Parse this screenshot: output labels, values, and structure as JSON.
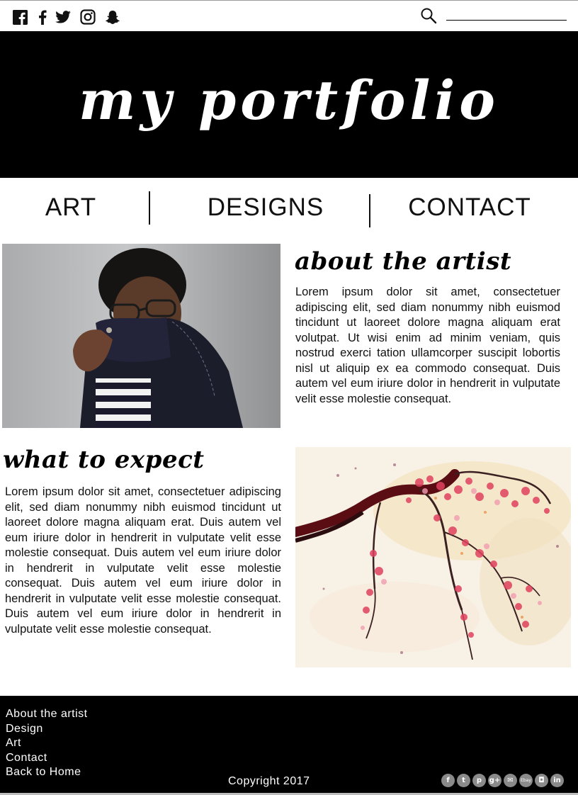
{
  "topbar": {
    "social_icons": [
      "facebook-square-icon",
      "facebook-icon",
      "twitter-icon",
      "instagram-icon",
      "snapchat-icon"
    ],
    "search": {
      "icon": "search-icon",
      "value": "",
      "placeholder": ""
    }
  },
  "hero": {
    "title": "my portfolio"
  },
  "nav": {
    "items": [
      "ART",
      "DESIGNS",
      "CONTACT"
    ]
  },
  "about": {
    "heading": "about the artist",
    "body": "Lorem ipsum dolor sit amet, consectetuer adipiscing elit, sed diam nonummy nibh euismod tincidunt ut laoreet dolore magna aliquam erat volutpat. Ut wisi enim ad minim veniam, quis nostrud exerci tation ullamcorper suscipit lobortis nisl ut aliquip ex ea commodo consequat. Duis autem vel eum iriure dolor in hendrerit in vulputate velit esse molestie consequat."
  },
  "expect": {
    "heading": "what to expect",
    "body": "Lorem ipsum dolor sit amet, consectetuer adipiscing elit, sed diam nonummy nibh euismod tincidunt ut laoreet dolore magna aliquam erat. Duis autem vel eum iriure dolor in hendrerit in vulputate velit esse molestie consequat. Duis autem vel eum iriure dolor in hendrerit in vulputate velit esse molestie consequat. Duis autem vel eum iriure dolor in hendrerit in vulputate velit esse molestie consequat. Duis autem vel eum iriure dolor in hendrerit in vulputate velit esse molestie consequat."
  },
  "footer": {
    "links": [
      "About the artist",
      "Design",
      "Art",
      "Contact",
      "Back to Home"
    ],
    "copyright": "Copyright 2017",
    "social_icons": [
      {
        "icon": "facebook-icon",
        "glyph": "f"
      },
      {
        "icon": "twitter-icon",
        "glyph": "t"
      },
      {
        "icon": "pinterest-icon",
        "glyph": "p"
      },
      {
        "icon": "google-plus-icon",
        "glyph": "g+"
      },
      {
        "icon": "email-icon",
        "glyph": "✉"
      },
      {
        "icon": "ebay-icon",
        "glyph": "Ebay"
      },
      {
        "icon": "instagram-icon",
        "glyph": "◘"
      },
      {
        "icon": "linkedin-icon",
        "glyph": "in"
      }
    ]
  },
  "colors": {
    "header_bg": "#000000",
    "footer_bg": "#000000",
    "text": "#111111",
    "footer_icon": "#8a8a8a"
  }
}
